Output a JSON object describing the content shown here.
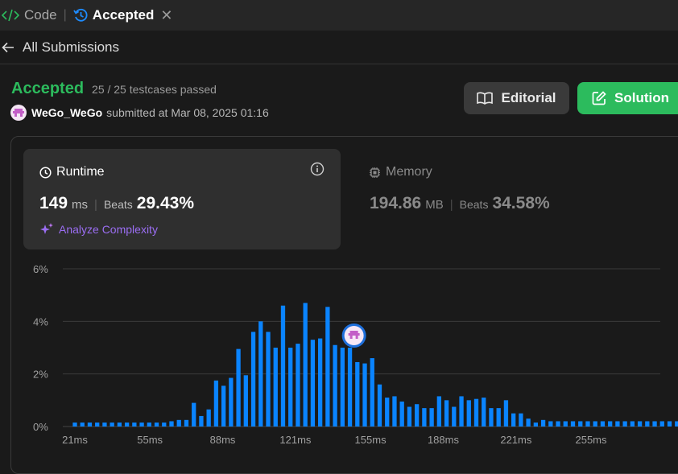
{
  "tabs": {
    "code": "Code",
    "accepted": "Accepted"
  },
  "back": {
    "label": "All Submissions"
  },
  "result": {
    "status": "Accepted",
    "testcases": "25 / 25 testcases passed",
    "username": "WeGo_WeGo",
    "submitted": "submitted at Mar 08, 2025 01:16"
  },
  "buttons": {
    "editorial": "Editorial",
    "solution": "Solution"
  },
  "runtime": {
    "title": "Runtime",
    "value": "149",
    "unit": "ms",
    "beats_label": "Beats",
    "beats": "29.43%",
    "analyze": "Analyze Complexity"
  },
  "memory": {
    "title": "Memory",
    "value": "194.86",
    "unit": "MB",
    "beats_label": "Beats",
    "beats": "34.58%"
  },
  "colors": {
    "accent_green": "#2cbb5d",
    "bar_blue": "#0a84ff",
    "purple": "#9b6ef3"
  },
  "chart_data": {
    "type": "bar",
    "yticks": [
      "0%",
      "2%",
      "4%",
      "6%"
    ],
    "ylim": [
      0,
      6
    ],
    "xticks": [
      "21ms",
      "55ms",
      "88ms",
      "121ms",
      "155ms",
      "188ms",
      "221ms",
      "255ms"
    ],
    "xlim": [
      21,
      300
    ],
    "bar_step_ms": 3.37,
    "values": [
      0.15,
      0.15,
      0.15,
      0.15,
      0.15,
      0.15,
      0.15,
      0.15,
      0.15,
      0.15,
      0.15,
      0.15,
      0.15,
      0.2,
      0.25,
      0.25,
      0.9,
      0.4,
      0.65,
      1.75,
      1.55,
      1.85,
      2.95,
      1.95,
      3.6,
      4.0,
      3.6,
      3.0,
      4.6,
      3.0,
      3.15,
      4.7,
      3.3,
      3.35,
      4.55,
      3.1,
      3.0,
      3.0,
      2.45,
      2.4,
      2.6,
      1.6,
      1.1,
      1.15,
      0.95,
      0.75,
      0.85,
      0.7,
      0.7,
      1.15,
      1.0,
      0.75,
      1.15,
      1.0,
      1.05,
      1.1,
      0.7,
      0.7,
      1.0,
      0.5,
      0.5,
      0.3,
      0.15,
      0.25,
      0.2,
      0.2,
      0.2,
      0.2,
      0.2,
      0.2,
      0.2,
      0.2,
      0.2,
      0.2,
      0.2,
      0.2,
      0.2,
      0.2,
      0.2,
      0.2,
      0.2,
      0.2,
      0.2,
      0.2,
      0.2
    ],
    "user_marker_ms": 149
  }
}
